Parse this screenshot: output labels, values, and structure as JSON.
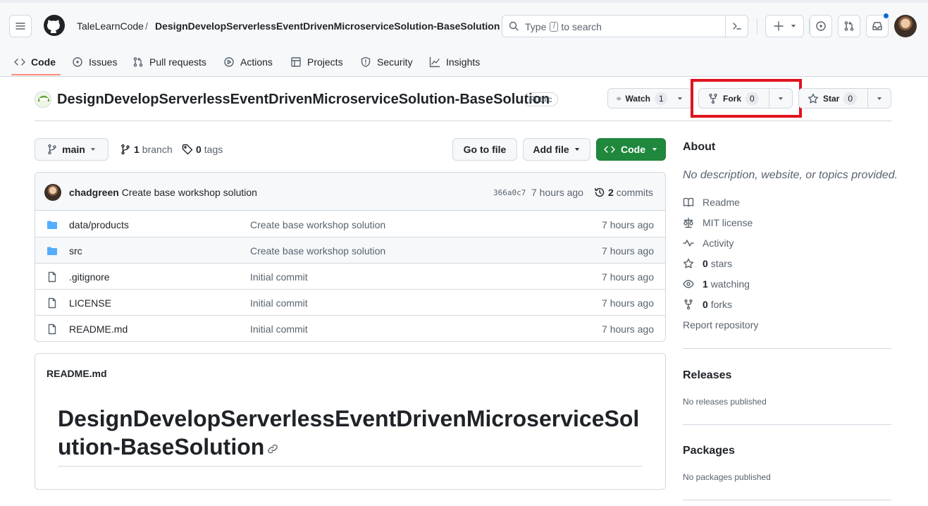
{
  "header": {
    "owner": "TaleLearnCode",
    "separator": "/",
    "repo": "DesignDevelopServerlessEventDrivenMicroserviceSolution-BaseSolution",
    "search_prefix": "Type",
    "search_key": "/",
    "search_suffix": "to search"
  },
  "nav": {
    "tabs": [
      {
        "label": "Code",
        "icon": "code-icon",
        "selected": true
      },
      {
        "label": "Issues",
        "icon": "issue-opened-icon"
      },
      {
        "label": "Pull requests",
        "icon": "git-pull-request-icon"
      },
      {
        "label": "Actions",
        "icon": "play-icon"
      },
      {
        "label": "Projects",
        "icon": "table-icon"
      },
      {
        "label": "Security",
        "icon": "shield-icon"
      },
      {
        "label": "Insights",
        "icon": "graph-icon"
      }
    ]
  },
  "repo_header": {
    "title": "DesignDevelopServerlessEventDrivenMicroserviceSolution-BaseSolution",
    "visibility": "Public",
    "watch_label": "Watch",
    "watch_count": "1",
    "fork_label": "Fork",
    "fork_count": "0",
    "star_label": "Star",
    "star_count": "0",
    "highlight_color": "#e0131f"
  },
  "toolbar": {
    "branch": "main",
    "branch_count": "1",
    "branch_word": "branch",
    "tag_count": "0",
    "tag_word": "tags",
    "go_to_file": "Go to file",
    "add_file": "Add file",
    "code": "Code",
    "code_color": "#1f883d"
  },
  "latest_commit": {
    "author": "chadgreen",
    "message": "Create base workshop solution",
    "sha": "366a0c7",
    "when": "7 hours ago",
    "commit_count": "2",
    "commit_word": "commits"
  },
  "files": [
    {
      "type": "dir",
      "name_prefix": "data/",
      "name": "products",
      "message": "Create base workshop solution",
      "date": "7 hours ago"
    },
    {
      "type": "dir",
      "name_prefix": "",
      "name": "src",
      "message": "Create base workshop solution",
      "date": "7 hours ago"
    },
    {
      "type": "file",
      "name_prefix": "",
      "name": ".gitignore",
      "message": "Initial commit",
      "date": "7 hours ago"
    },
    {
      "type": "file",
      "name_prefix": "",
      "name": "LICENSE",
      "message": "Initial commit",
      "date": "7 hours ago"
    },
    {
      "type": "file",
      "name_prefix": "",
      "name": "README.md",
      "message": "Initial commit",
      "date": "7 hours ago"
    }
  ],
  "readme": {
    "label": "README.md",
    "heading": "DesignDevelopServerlessEventDrivenMicroserviceSolution-BaseSolution"
  },
  "sidebar": {
    "about_title": "About",
    "description": "No description, website, or topics provided.",
    "readme": "Readme",
    "license": "MIT license",
    "activity": "Activity",
    "stars_count": "0",
    "stars_word": "stars",
    "watching_count": "1",
    "watching_word": "watching",
    "forks_count": "0",
    "forks_word": "forks",
    "report": "Report repository",
    "releases_title": "Releases",
    "releases_text": "No releases published",
    "packages_title": "Packages",
    "packages_text": "No packages published"
  }
}
